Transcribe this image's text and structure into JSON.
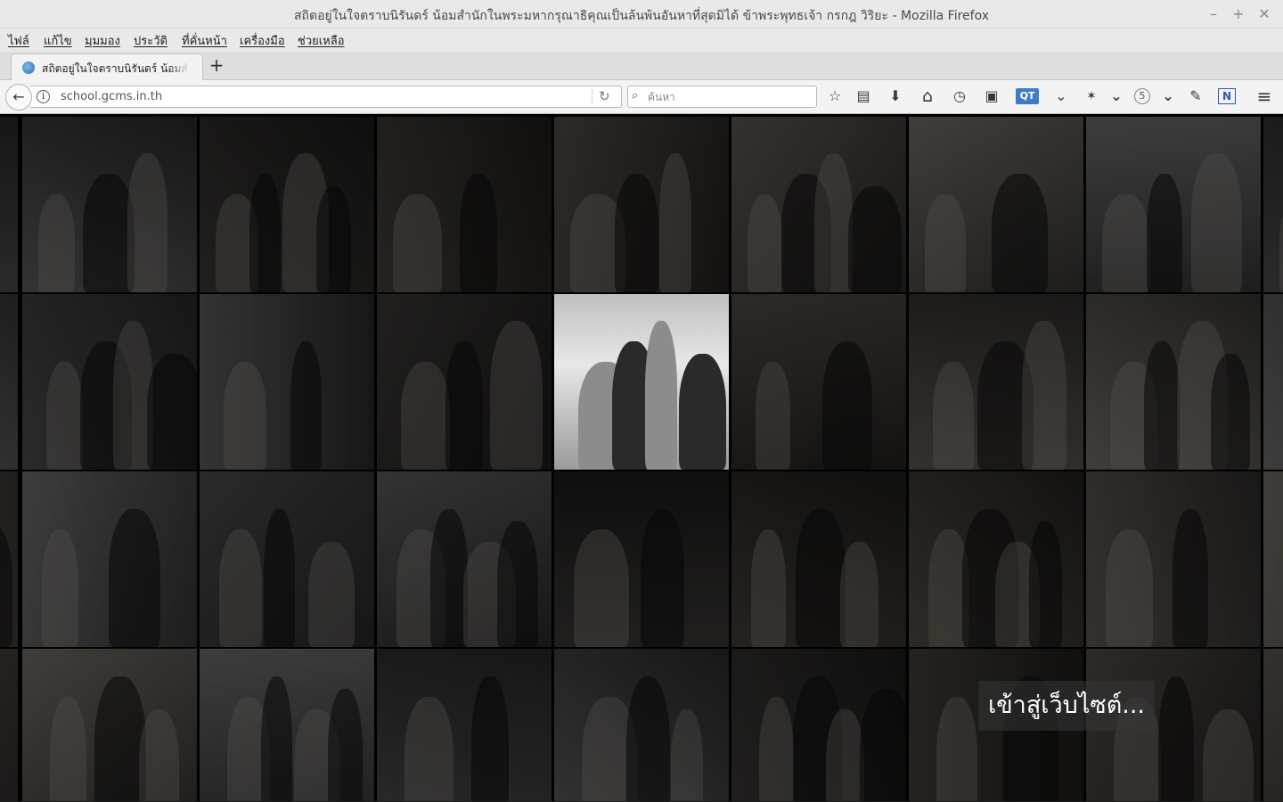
{
  "window": {
    "title": "สถิตอยู่ในใจตราบนิรันดร์ น้อมสำนักในพระมหากรุณาธิคุณเป็นล้นพ้นอันหาที่สุดมิได้ ข้าพระพุทธเจ้า กรกฎ วิริยะ - Mozilla Firefox",
    "minimize": "–",
    "maximize": "+",
    "close": "✕"
  },
  "menu": {
    "items": [
      "ไฟล์",
      "แก้ไข",
      "มุมมอง",
      "ประวัติ",
      "ที่คั่นหน้า",
      "เครื่องมือ",
      "ช่วยเหลือ"
    ]
  },
  "tabs": [
    {
      "label": "สถิตอยู่ในใจตราบนิรันดร์ น้อมสำนักในพระมหากรุณาธิคุณ"
    }
  ],
  "new_tab": "+",
  "nav": {
    "back": "←",
    "info": "i",
    "url": "school.gcms.in.th",
    "reload": "↻",
    "search_placeholder": "ค้นหา",
    "search_icon": "⌕"
  },
  "toolbar": {
    "bookmark_star": "☆",
    "bookmarks_menu": "▤",
    "downloads": "⬇",
    "home": "⌂",
    "history_clock": "◷",
    "screenshot": "▣",
    "addon_qt": "QT",
    "dropdown_a": "⌄",
    "addon_bird": "✶",
    "pocket": "⌄",
    "badge": "5",
    "pocket_b": "⌄",
    "eyedropper": "✎",
    "addon_n": "N",
    "hamburger": "≡"
  },
  "page": {
    "enter_button": "เข้าสู่เว็บไซต์..."
  },
  "colors": {
    "chrome_bg": "#e9e9e9",
    "page_bg": "#000000",
    "overlay": "#373737"
  }
}
